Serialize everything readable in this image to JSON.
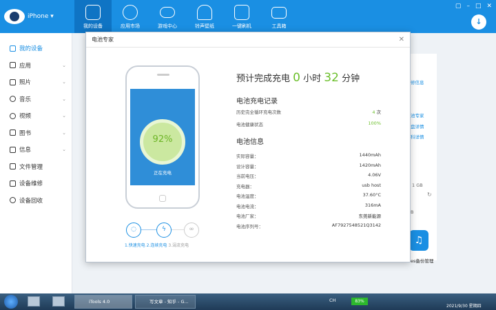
{
  "app": {
    "device_name": "iPhone ▾"
  },
  "nav": [
    {
      "label": "我的设备"
    },
    {
      "label": "应用市场"
    },
    {
      "label": "游戏中心"
    },
    {
      "label": "铃声壁纸"
    },
    {
      "label": "一键刷机"
    },
    {
      "label": "工具箱"
    }
  ],
  "window_controls": [
    "▢",
    "–",
    "□",
    "✕"
  ],
  "sidebar": [
    {
      "label": "我的设备"
    },
    {
      "label": "应用"
    },
    {
      "label": "照片"
    },
    {
      "label": "音乐"
    },
    {
      "label": "视频"
    },
    {
      "label": "图书"
    },
    {
      "label": "信息"
    },
    {
      "label": "文件管理"
    },
    {
      "label": "设备维修"
    },
    {
      "label": "设备回收"
    }
  ],
  "background": {
    "links": [
      "修信息",
      "池专家",
      "盘详情",
      "科详情"
    ],
    "storage": "1 GB",
    "storage_b": "B",
    "backup": "es备份管理"
  },
  "dialog": {
    "title": "电池专家",
    "battery_percent": "92%",
    "charging_status": "正在充电",
    "modes": [
      "1.快速充电",
      "2.连续充电",
      "3.涓流充电"
    ],
    "headline": {
      "prefix": "预计完成充电",
      "hours": "0",
      "hours_unit": "小时",
      "minutes": "32",
      "minutes_unit": "分钟"
    },
    "record_title": "电池充电记录",
    "records": [
      {
        "label": "历史完全循环充电次数",
        "value": "4",
        "unit": "次"
      },
      {
        "label": "电池健康状态",
        "value": "100%",
        "unit": ""
      }
    ],
    "info_title": "电池信息",
    "info": [
      {
        "label": "实际容量：",
        "value": "1440mAh"
      },
      {
        "label": "设计容量：",
        "value": "1420mAh"
      },
      {
        "label": "当前电压：",
        "value": "4.06V"
      },
      {
        "label": "充电器：",
        "value": "usb host"
      },
      {
        "label": "电池温度：",
        "value": "37.60°C"
      },
      {
        "label": "电池电流：",
        "value": "316mA"
      },
      {
        "label": "电池厂家：",
        "value": "东莞新能源"
      },
      {
        "label": "电池序列号：",
        "value": "AF7927548521Q3142"
      }
    ]
  },
  "taskbar": {
    "tasks": [
      "iTools 4.0",
      "写文章 - 知乎 - G..."
    ],
    "ime": "CH",
    "battery": "83%",
    "date": "2021/9/30 星期四"
  }
}
